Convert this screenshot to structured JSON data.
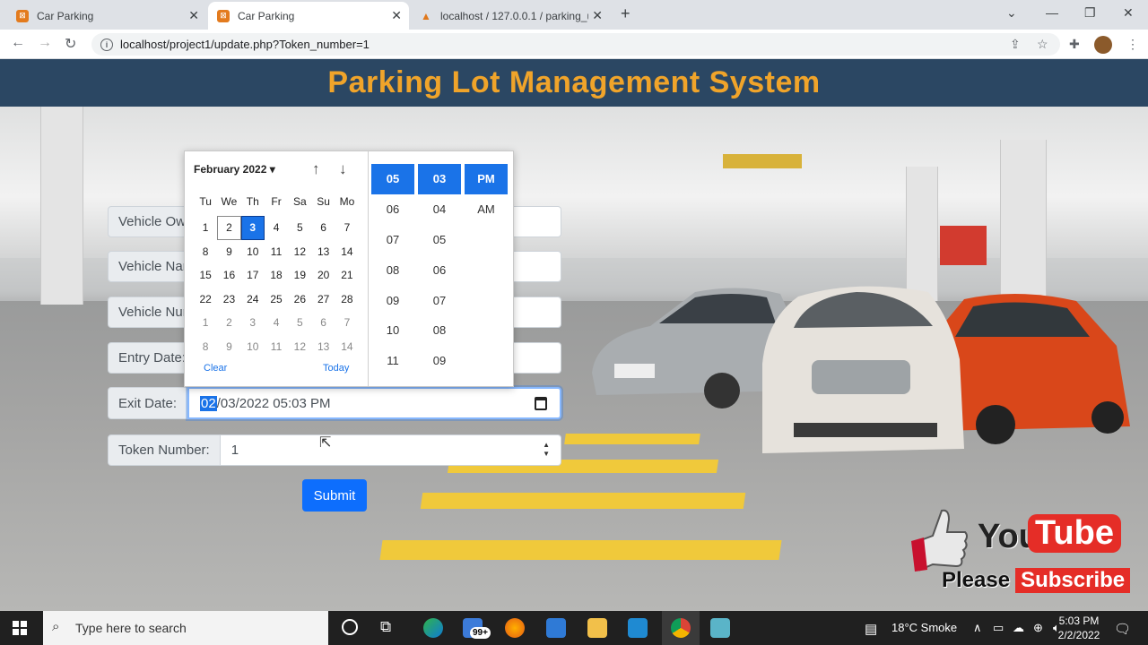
{
  "browser": {
    "tabs": [
      {
        "label": "Car Parking",
        "active": false
      },
      {
        "label": "Car Parking",
        "active": true
      },
      {
        "label": "localhost / 127.0.0.1 / parking_up",
        "active": false
      }
    ],
    "url": "localhost/project1/update.php?Token_number=1"
  },
  "header": {
    "title": "Parking Lot Management System"
  },
  "form": {
    "owner_label": "Vehicle Ow",
    "name_label": "Vehicle Nar",
    "number_label": "Vehicle Nur",
    "entry_label": "Entry Date:",
    "exit_label": "Exit Date:",
    "exit_value_selected": "02",
    "exit_value_rest": "/03/2022 05:03 PM",
    "token_label": "Token Number:",
    "token_value": "1",
    "submit_label": "Submit"
  },
  "picker": {
    "month": "February 2022",
    "weekdays": [
      "Tu",
      "We",
      "Th",
      "Fr",
      "Sa",
      "Su",
      "Mo"
    ],
    "days": [
      {
        "d": "1"
      },
      {
        "d": "2",
        "state": "today"
      },
      {
        "d": "3",
        "state": "cur"
      },
      {
        "d": "4"
      },
      {
        "d": "5"
      },
      {
        "d": "6"
      },
      {
        "d": "7"
      },
      {
        "d": "8"
      },
      {
        "d": "9"
      },
      {
        "d": "10"
      },
      {
        "d": "11"
      },
      {
        "d": "12"
      },
      {
        "d": "13"
      },
      {
        "d": "14"
      },
      {
        "d": "15"
      },
      {
        "d": "16"
      },
      {
        "d": "17"
      },
      {
        "d": "18"
      },
      {
        "d": "19"
      },
      {
        "d": "20"
      },
      {
        "d": "21"
      },
      {
        "d": "22"
      },
      {
        "d": "23"
      },
      {
        "d": "24"
      },
      {
        "d": "25"
      },
      {
        "d": "26"
      },
      {
        "d": "27"
      },
      {
        "d": "28"
      },
      {
        "d": "1",
        "state": "dim"
      },
      {
        "d": "2",
        "state": "dim"
      },
      {
        "d": "3",
        "state": "dim"
      },
      {
        "d": "4",
        "state": "dim"
      },
      {
        "d": "5",
        "state": "dim"
      },
      {
        "d": "6",
        "state": "dim"
      },
      {
        "d": "7",
        "state": "dim"
      },
      {
        "d": "8",
        "state": "dim"
      },
      {
        "d": "9",
        "state": "dim"
      },
      {
        "d": "10",
        "state": "dim"
      },
      {
        "d": "11",
        "state": "dim"
      },
      {
        "d": "12",
        "state": "dim"
      },
      {
        "d": "13",
        "state": "dim"
      },
      {
        "d": "14",
        "state": "dim"
      }
    ],
    "clear": "Clear",
    "today": "Today",
    "hours": [
      "05",
      "06",
      "07",
      "08",
      "09",
      "10",
      "11"
    ],
    "minutes": [
      "03",
      "04",
      "05",
      "06",
      "07",
      "08",
      "09"
    ],
    "ampm": [
      "PM",
      "AM"
    ]
  },
  "youtube": {
    "word1": "You",
    "word2": "Tube",
    "please": "Please",
    "subscribe": "Subscribe"
  },
  "taskbar": {
    "search_placeholder": "Type here to search",
    "weather": "18°C  Smoke",
    "time": "5:03 PM",
    "date": "2/2/2022",
    "badge": "99+"
  },
  "colors": {
    "header_bg": "#2b4763",
    "title": "#f0a42a",
    "accent": "#1a73e8",
    "submit": "#0d6efd"
  }
}
